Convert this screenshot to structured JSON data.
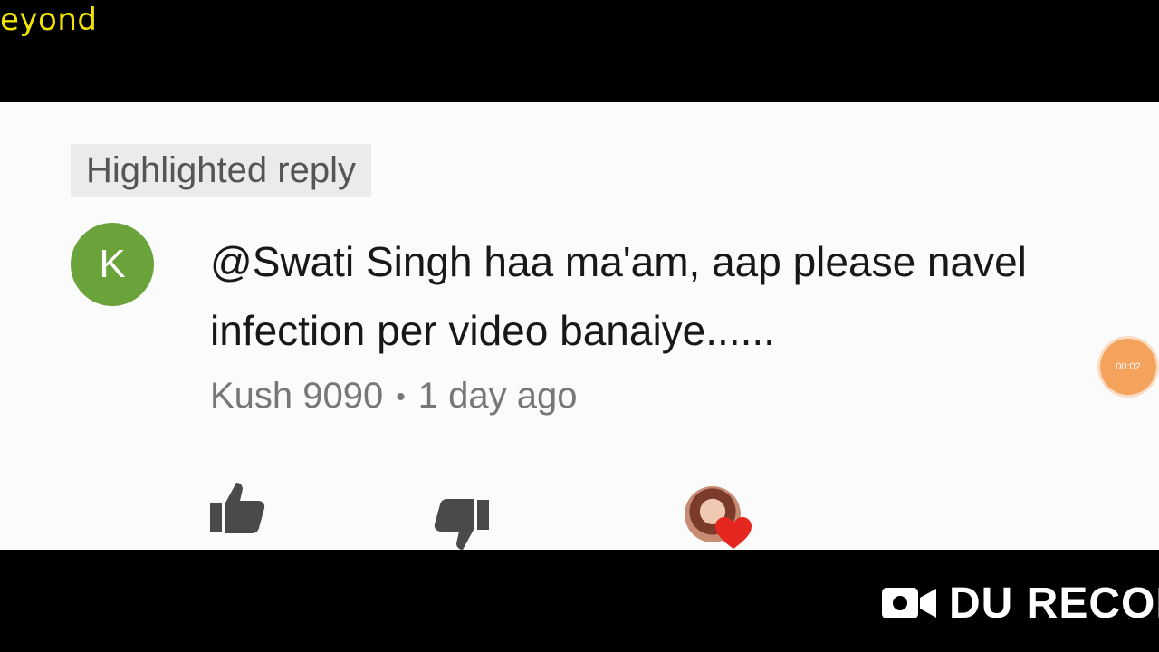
{
  "overlay": {
    "top_text": "eyond",
    "timer": "00:02",
    "recorder_label": "DU RECOR"
  },
  "comment": {
    "badge": "Highlighted reply",
    "avatar_letter": "K",
    "text": "@Swati Singh haa ma'am, aap please navel infection per video banaiye......",
    "author": "Kush 9090",
    "separator": "•",
    "time": "1 day ago"
  },
  "icons": {
    "like": "thumbs-up-icon",
    "dislike": "thumbs-down-icon",
    "creator_heart": "heart-icon",
    "recorder": "video-camera-icon"
  },
  "colors": {
    "overlay_text": "#f2e200",
    "avatar_bg": "#6aa33a",
    "heart": "#e5281f",
    "timer_bubble": "#f5a25d"
  }
}
